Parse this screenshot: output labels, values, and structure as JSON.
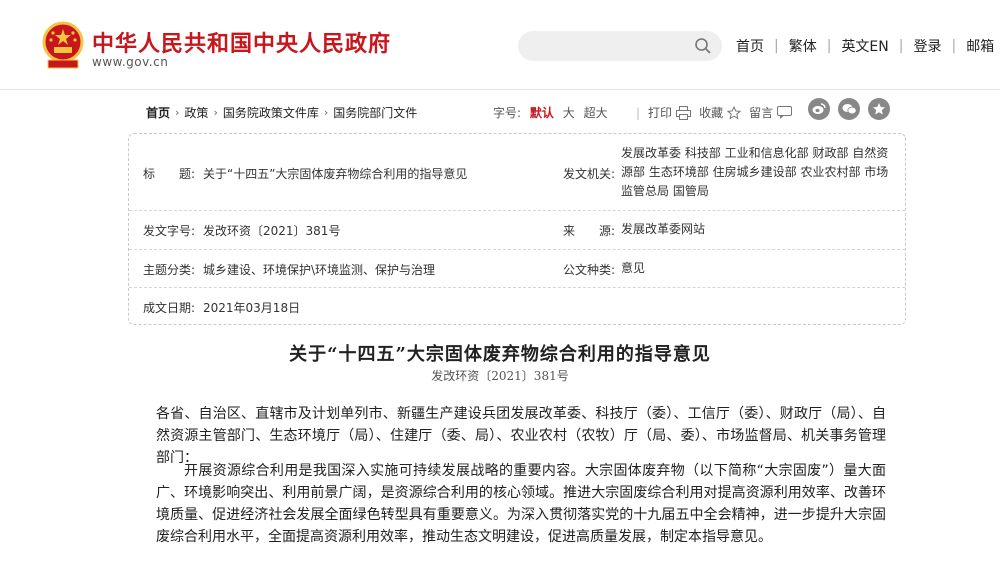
{
  "header": {
    "site_title": "中华人民共和国中央人民政府",
    "site_url": "www.gov.cn",
    "search_placeholder": "",
    "nav": [
      "首页",
      "繁体",
      "英文EN",
      "登录",
      "邮箱"
    ]
  },
  "breadcrumb": [
    "首页",
    "政策",
    "国务院政策文件库",
    "国务院部门文件"
  ],
  "font_size": {
    "label": "字号:",
    "options": [
      "默认",
      "大",
      "超大"
    ],
    "selected": "默认"
  },
  "tools": {
    "print": "打印",
    "favorite": "收藏",
    "comment": "留言"
  },
  "share_icons": [
    "weibo-icon",
    "wechat-icon",
    "star-icon"
  ],
  "info": {
    "title_label": "标　　题:",
    "title_value": "关于“十四五”大宗固体废弃物综合利用的指导意见",
    "issuer_label": "发文机关:",
    "issuer_value": "发展改革委 科技部 工业和信息化部 财政部 自然资源部 生态环境部 住房城乡建设部 农业农村部 市场监管总局 国管局",
    "doc_no_label": "发文字号:",
    "doc_no_value": "发改环资〔2021〕381号",
    "source_label": "来　　源:",
    "source_value": "发展改革委网站",
    "topic_label": "主题分类:",
    "topic_value": "城乡建设、环境保护\\环境监测、保护与治理",
    "doctype_label": "公文种类:",
    "doctype_value": "意见",
    "date_label": "成文日期:",
    "date_value": "2021年03月18日"
  },
  "article": {
    "title": "关于“十四五”大宗固体废弃物综合利用的指导意见",
    "doc_no": "发改环资〔2021〕381号",
    "para1": "各省、自治区、直辖市及计划单列市、新疆生产建设兵团发展改革委、科技厅（委）、工信厅（委）、财政厅（局）、自然资源主管部门、生态环境厅（局）、住建厅（委、局）、农业农村（农牧）厅（局、委）、市场监督局、机关事务管理部门：",
    "para2": "开展资源综合利用是我国深入实施可持续发展战略的重要内容。大宗固体废弃物（以下简称“大宗固废”）量大面广、环境影响突出、利用前景广阔，是资源综合利用的核心领域。推进大宗固废综合利用对提高资源利用效率、改善环境质量、促进经济社会发展全面绿色转型具有重要意义。为深入贯彻落实党的十九届五中全会精神，进一步提升大宗固废综合利用水平，全面提高资源利用效率，推动生态文明建设，促进高质量发展，制定本指导意见。"
  },
  "colors": {
    "brand_red": "#c8161d",
    "emblem_gold": "#f4c542"
  }
}
